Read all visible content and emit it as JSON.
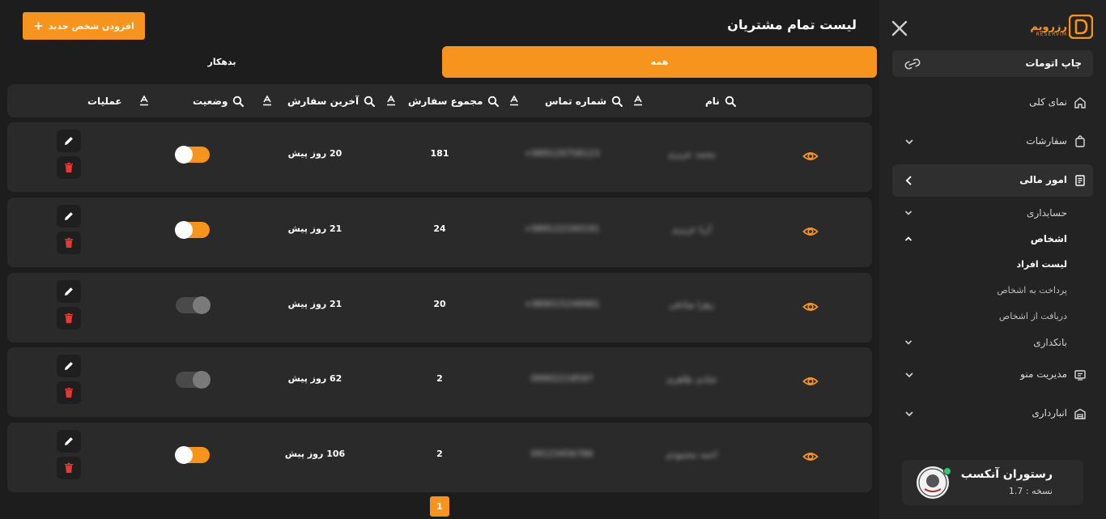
{
  "brand": {
    "name": "رزرویم",
    "tagline": "RESERVIM",
    "accent": "#f7941d"
  },
  "sidebar": {
    "print_label": "چاپ اتومات",
    "menu": [
      {
        "label": "نمای کلی",
        "icon": "home-icon"
      },
      {
        "label": "سفارشات",
        "icon": "bag-icon"
      },
      {
        "label": "امور مالی",
        "icon": "receipt-icon"
      }
    ],
    "finance_sub": [
      {
        "label": "حسابداری"
      },
      {
        "label": "اشخاص"
      }
    ],
    "persons_leaves": [
      {
        "label": "لیست افراد"
      },
      {
        "label": "پرداخت به اشخاص"
      },
      {
        "label": "دریافت از اشخاص"
      }
    ],
    "bottom_sub": [
      {
        "label": "بانکداری"
      }
    ],
    "bottom_menu": [
      {
        "label": "مدیریت منو",
        "icon": "menu-board-icon"
      },
      {
        "label": "انبارداری",
        "icon": "warehouse-icon"
      }
    ],
    "user": {
      "name": "رستوران آنکسب",
      "version": "نسخه : 1.7"
    }
  },
  "main": {
    "title": "لیست تمام مشتریان",
    "add_button": "افزودن شخص جدید",
    "tabs": {
      "all": "همه",
      "debtor": "بدهکار"
    },
    "columns": {
      "name": "نام",
      "phone": "شماره تماس",
      "total": "مجموع سفارش",
      "last": "آخرین سفارش",
      "status": "وضعیت",
      "actions": "عملیات"
    },
    "rows": [
      {
        "name": "محمد عزیزی",
        "phone": "+989129758123",
        "total": "181",
        "last": "20 روز پیش",
        "active": true
      },
      {
        "name": "آریا عزیزی",
        "phone": "+989122160191",
        "total": "24",
        "last": "21 روز پیش",
        "active": true
      },
      {
        "name": "زهرا صادقی",
        "phone": "+989015248981",
        "total": "20",
        "last": "21 روز پیش",
        "active": false
      },
      {
        "name": "شادی طاهری",
        "phone": "09902218597",
        "total": "2",
        "last": "62 روز پیش",
        "active": false
      },
      {
        "name": "احمد محمودی",
        "phone": "09123456786",
        "total": "2",
        "last": "106 روز پیش",
        "active": true
      }
    ],
    "page": "1"
  }
}
